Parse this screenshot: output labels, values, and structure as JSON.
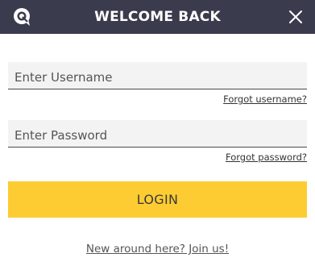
{
  "header": {
    "title": "WELCOME BACK",
    "logo_icon": "chat-bubble-logo-icon",
    "close_icon": "close-icon",
    "background_color": "#3a3b4c"
  },
  "form": {
    "username": {
      "placeholder": "Enter Username",
      "value": ""
    },
    "forgot_username": "Forgot username?",
    "password": {
      "placeholder": "Enter Password",
      "value": ""
    },
    "forgot_password": "Forgot password?",
    "login_label": "LOGIN",
    "login_color": "#fdcc32"
  },
  "footer": {
    "join_link": "New around here? Join us!"
  }
}
